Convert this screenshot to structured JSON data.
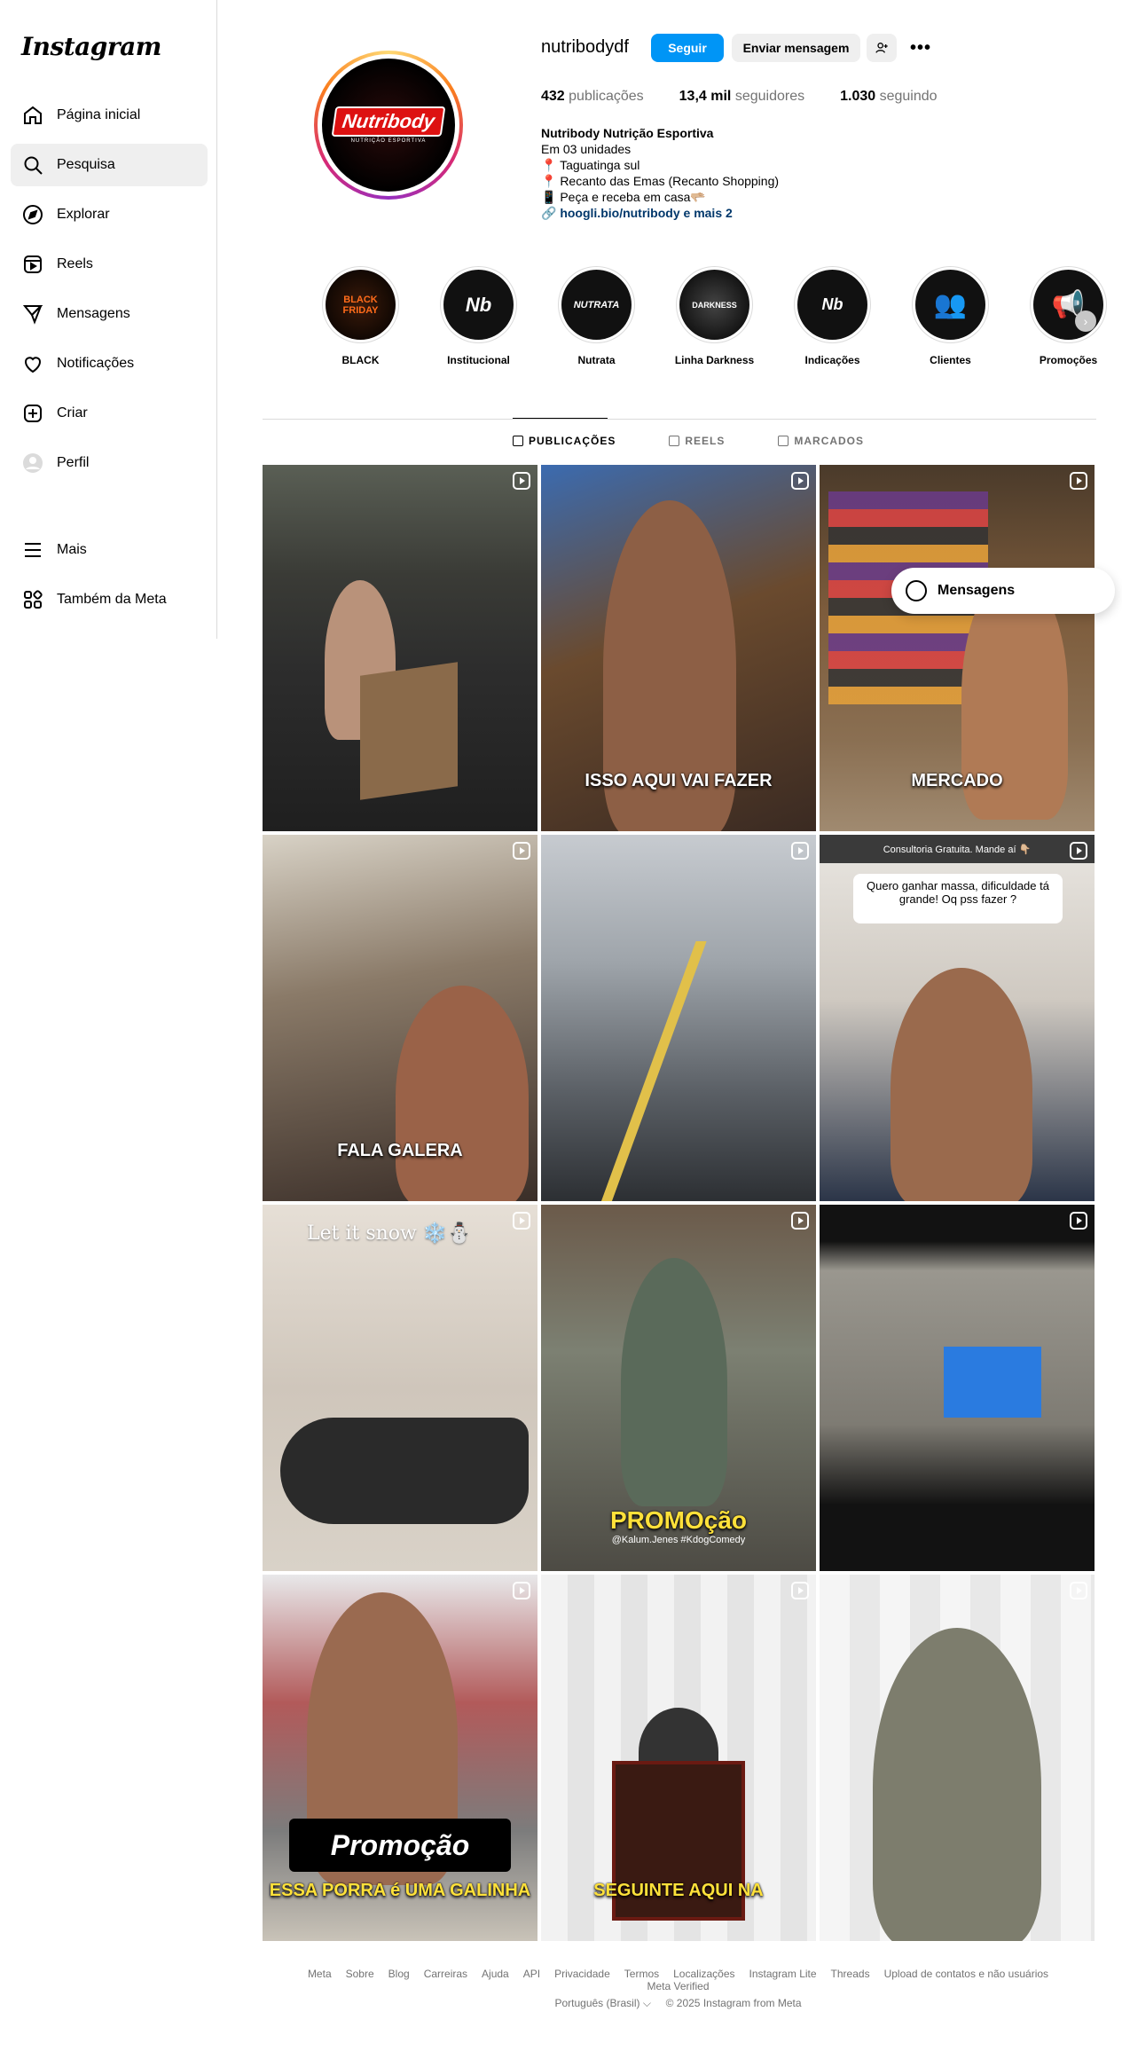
{
  "app": {
    "logo_text": "Instagram"
  },
  "sidebar": {
    "items": [
      {
        "label": "Página inicial",
        "icon": "home-icon"
      },
      {
        "label": "Pesquisa",
        "icon": "search-icon",
        "active": true
      },
      {
        "label": "Explorar",
        "icon": "compass-icon"
      },
      {
        "label": "Reels",
        "icon": "reels-icon"
      },
      {
        "label": "Mensagens",
        "icon": "paper-plane-icon"
      },
      {
        "label": "Notificações",
        "icon": "heart-icon"
      },
      {
        "label": "Criar",
        "icon": "plus-square-icon"
      },
      {
        "label": "Perfil",
        "icon": "profile-avatar-icon"
      }
    ],
    "bottom_items": [
      {
        "label": "Mais",
        "icon": "menu-icon"
      },
      {
        "label": "Também da Meta",
        "icon": "meta-apps-icon"
      }
    ]
  },
  "profile": {
    "username": "nutribodydf",
    "avatar_brand": "Nutribody",
    "avatar_sub": "NUTRIÇÃO ESPORTIVA",
    "follow_label": "Seguir",
    "message_label": "Enviar mensagem",
    "more_label": "•••",
    "stats": {
      "posts_count": "432",
      "posts_label": "publicações",
      "followers_count": "13,4 mil",
      "followers_label": "seguidores",
      "following_count": "1.030",
      "following_label": "seguindo"
    },
    "bio": {
      "name": "Nutribody Nutrição Esportiva",
      "line1": "Em 03 unidades",
      "line2": "📍 Taguatinga sul",
      "line3": "📍 Recanto das Emas (Recanto Shopping)",
      "line4": "📱 Peça e receba em casa🫳🏼",
      "link": "🔗 hoogli.bio/nutribody e mais 2"
    }
  },
  "highlights": [
    {
      "label": "BLACK",
      "thumb": "BLACK FRIDAY"
    },
    {
      "label": "Institucional",
      "thumb": "Nb"
    },
    {
      "label": "Nutrata",
      "thumb": "NUTRATA"
    },
    {
      "label": "Linha Darkness",
      "thumb": "DARKNESS"
    },
    {
      "label": "Indicações",
      "thumb": "Nb"
    },
    {
      "label": "Clientes",
      "thumb": "👥"
    },
    {
      "label": "Promoções",
      "thumb": "📢"
    }
  ],
  "tabs": [
    {
      "label": "PUBLICAÇÕES",
      "active": true
    },
    {
      "label": "REELS"
    },
    {
      "label": "MARCADOS"
    }
  ],
  "posts": [
    {
      "caption": ""
    },
    {
      "caption": "ISSO AQUI VAI FAZER"
    },
    {
      "caption": "MERCADO"
    },
    {
      "caption": "FALA GALERA"
    },
    {
      "caption": ""
    },
    {
      "caption": "Quero ganhar massa, dificuldade tá grande! Oq pss fazer ?",
      "banner": "Consultoria Gratuita. Mande aí 👇🏼"
    },
    {
      "caption": "Let it snow ❄️⛄"
    },
    {
      "caption": "PROMOção",
      "sub": "@Kalum.Jenes #KdogComedy"
    },
    {
      "caption": ""
    },
    {
      "caption": "Promoção",
      "sub": "ESSA PORRA é UMA GALINHA"
    },
    {
      "caption": "SEGUINTE AQUI NA"
    },
    {
      "caption": ""
    }
  ],
  "floating_messages_label": "Mensagens",
  "footer": {
    "links": [
      "Meta",
      "Sobre",
      "Blog",
      "Carreiras",
      "Ajuda",
      "API",
      "Privacidade",
      "Termos",
      "Localizações",
      "Instagram Lite",
      "Threads",
      "Upload de contatos e não usuários",
      "Meta Verified"
    ],
    "language": "Português (Brasil) ⌵",
    "copyright": "© 2025 Instagram from Meta"
  },
  "colors": {
    "accent": "#0095f6",
    "muted": "#737373",
    "brand_red": "#d11111"
  }
}
